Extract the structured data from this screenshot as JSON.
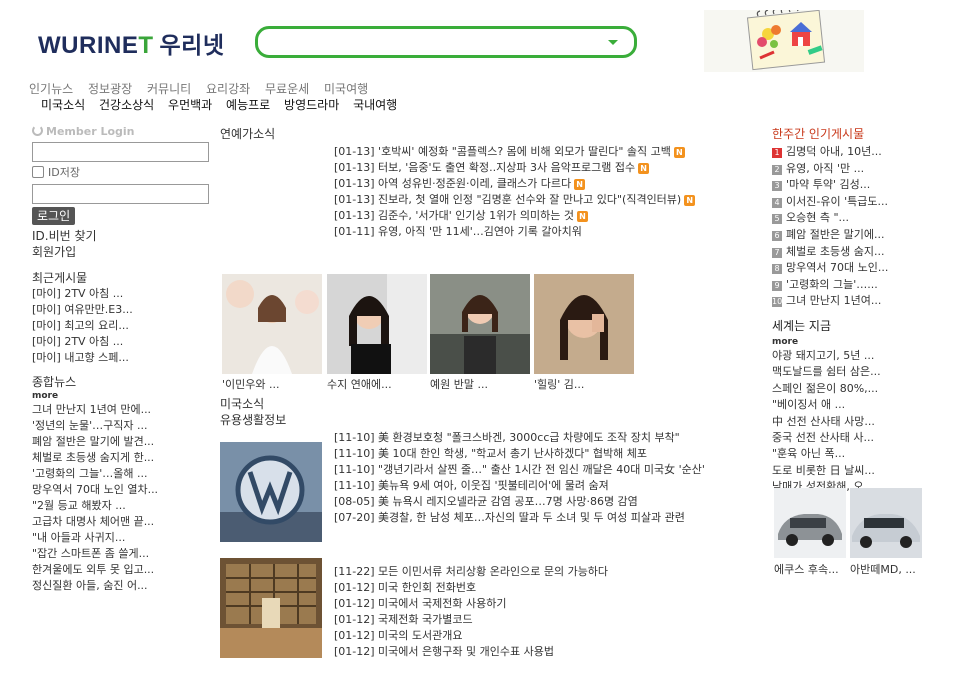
{
  "header": {
    "logo_brand": "WURINE",
    "logo_t": "T",
    "logo_korean": "우리넷",
    "search_value": ""
  },
  "nav_top": [
    "인기뉴스",
    "정보광장",
    "커뮤니티",
    "요리강좌",
    "무료운세",
    "미국여행"
  ],
  "nav_sub": [
    "미국소식",
    "건강소상식",
    "우먼백과",
    "예능프로",
    "방영드라마",
    "국내여행"
  ],
  "login": {
    "title": "Member Login",
    "save_label": "ID저장",
    "button": "로그인",
    "find_label": "ID.비번 찾기",
    "join_label": "회원가입"
  },
  "recent": {
    "title": "최근게시물",
    "items": [
      "[마이] 2TV 아침 ...",
      "[마이] 여유만만.E3...",
      "[마이] 최고의 요리...",
      "[마이] 2TV 아침 ...",
      "[마이] 내고향 스페..."
    ]
  },
  "general_news": {
    "title": "종합뉴스",
    "more": "more",
    "items": [
      "그녀 만난지 1년여 만에...",
      "'정년의 눈물'…구직자 ...",
      "폐암 절반은 말기에 발견...",
      "체벌로 초등생 숨지게 한...",
      "'고령화의 그늘'…올해 ...",
      "망우역서 70대 노인 열차...",
      "\"2월 등교 해봤자 ...",
      "고급차 대명사 체어맨 끝...",
      "\"내 아들과 사귀지...",
      "\"잡간 스마트폰 좀 쓸게...",
      "한겨울에도 외투 못 입고...",
      "정신질환 아들, 숨진 어..."
    ]
  },
  "entertainment": {
    "title": "연예가소식",
    "items": [
      {
        "date": "[01-13]",
        "text": "'호박씨' 예정화 \"콤플렉스? 몸에 비해 외모가 딸린다\" 솔직 고백",
        "new": true
      },
      {
        "date": "[01-13]",
        "text": "터보, '음중'도 출연 확정..지상파 3사 음악프로그램 접수",
        "new": true
      },
      {
        "date": "[01-13]",
        "text": "아역 성유빈·정준원·이레, 클래스가 다르다",
        "new": true
      },
      {
        "date": "[01-13]",
        "text": "진보라, 첫 열애 인정 \"김명훈 선수와 잘 만나고 있다\"(직격인터뷰)",
        "new": true
      },
      {
        "date": "[01-13]",
        "text": "김준수, '서가대' 인기상 1위가 의미하는 것",
        "new": true
      },
      {
        "date": "[01-11]",
        "text": "유영, 아직 '만 11세'…김연아 기록 갈아치워",
        "new": false
      }
    ],
    "photos": [
      "'이민우와 ...",
      "수지 연애에...",
      "예원 반말 ...",
      "'힐링' 김..."
    ],
    "new_badge": "N"
  },
  "us_news": {
    "title": "미국소식",
    "subtitle": "유용생활정보",
    "items": [
      {
        "date": "[11-10]",
        "text": "美 환경보호청 \"폴크스바겐, 3000cc급 차량에도 조작 장치 부착\""
      },
      {
        "date": "[11-10]",
        "text": "美 10대 한인 학생, \"학교서 총기 난사하겠다\" 협박해 체포"
      },
      {
        "date": "[11-10]",
        "text": "\"갱년기라서 살찐 줄…\" 출산 1시간 전 임신 깨달은 40대 미국女 '순산'"
      },
      {
        "date": "[11-10]",
        "text": "美뉴욕 9세 여아, 이웃집 '핏불테리어'에 물려 숨져"
      },
      {
        "date": "[08-05]",
        "text": "美 뉴욕시 레지오넬라균 감염 공포…7명 사망·86명 감염"
      },
      {
        "date": "[07-20]",
        "text": "美경찰, 한 남성 체포…자신의 딸과 두 소녀 및 두 여성 피살과 관련"
      }
    ]
  },
  "life_info": {
    "items": [
      {
        "date": "[11-22]",
        "text": "모든 이민서류 처리상황 온라인으로 문의 가능하다"
      },
      {
        "date": "[01-12]",
        "text": "미국 한인회 전화번호"
      },
      {
        "date": "[01-12]",
        "text": "미국에서 국제전화 사용하기"
      },
      {
        "date": "[01-12]",
        "text": "국제전화 국가별코드"
      },
      {
        "date": "[01-12]",
        "text": "미국의 도서관개요"
      },
      {
        "date": "[01-12]",
        "text": "미국에서 은행구좌 및 개인수표 사용법"
      }
    ]
  },
  "weekly_popular": {
    "title": "한주간 인기게시물",
    "items": [
      "김명덕 아내, 10년...",
      "유영, 아직 '만 ...",
      "'마약 투약' 김성...",
      "이서진-유이 '특급도...",
      "오승현 측 \"...",
      "폐암 절반은 말기에...",
      "체벌로 초등생 숨지...",
      "망우역서 70대 노인...",
      "'고령화의 그늘'…...",
      "그녀 만난지 1년여..."
    ]
  },
  "world_now": {
    "title": "세계는 지금",
    "more": "more",
    "items": [
      "야광 돼지고기, 5년 ...",
      "맥도날드를 쉼터 삼은...",
      "스페인 젊은이 80%,...",
      "\"베이징서 애 ...",
      "中 선전 산사태 사망...",
      "중국 선전 산사태 사...",
      "\"훈육 아닌 폭...",
      "도로 비롯한 日 날씨...",
      "남매가 성전환해, 오..."
    ]
  },
  "cars": {
    "captions": [
      "에쿠스 후속...",
      "아반떼MD, ..."
    ]
  },
  "colors": {
    "accent_green": "#3aad3a",
    "logo_navy": "#1f2d5c",
    "rank_red": "#c8381a",
    "new_badge_orange": "#f3921e"
  }
}
